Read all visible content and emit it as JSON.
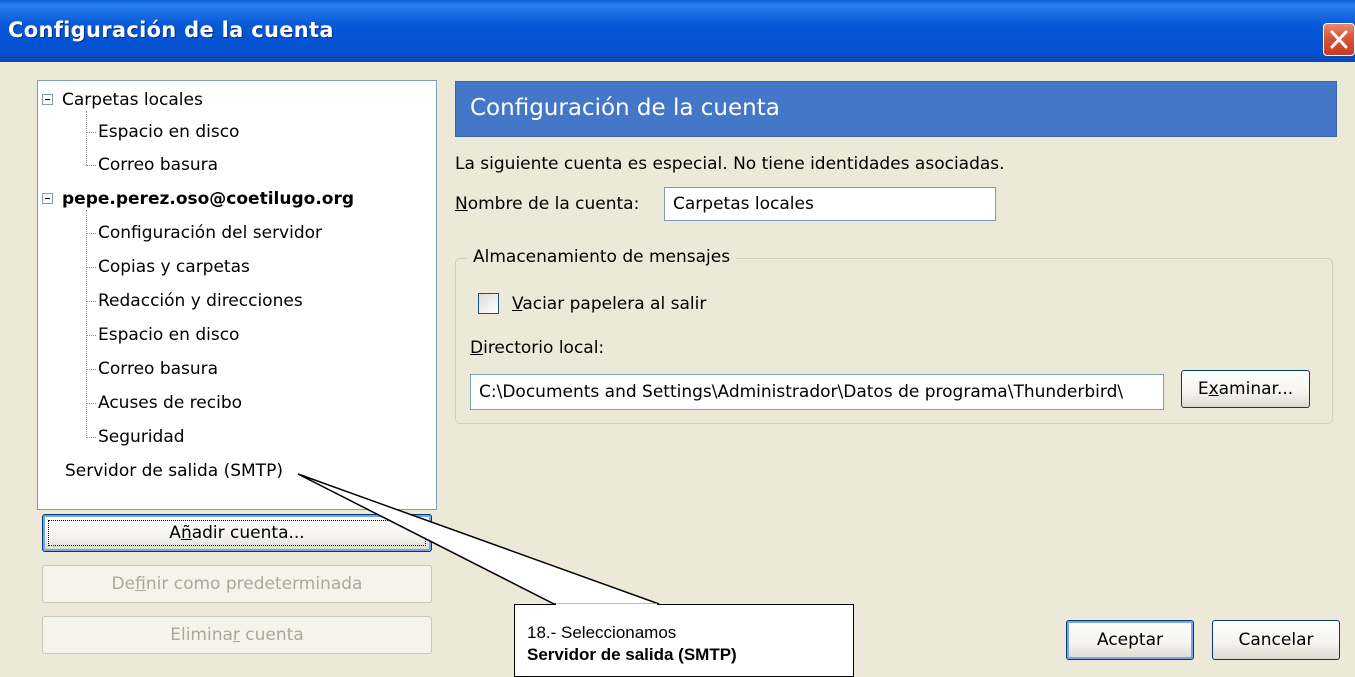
{
  "window": {
    "title": "Configuración de la cuenta"
  },
  "tree": {
    "groups": [
      {
        "label": "Carpetas locales",
        "bold": false,
        "children": [
          "Espacio en disco",
          "Correo basura"
        ]
      },
      {
        "label": "pepe.perez.oso@coetilugo.org",
        "bold": true,
        "children": [
          "Configuración del servidor",
          "Copias y carpetas",
          "Redacción y direcciones",
          "Espacio en disco",
          "Correo basura",
          "Acuses de recibo",
          "Seguridad"
        ]
      }
    ],
    "footer_item": "Servidor de salida (SMTP)"
  },
  "left_buttons": {
    "add_account_prefix": "A",
    "add_account_accel": "ñ",
    "add_account_suffix": "adir cuenta...",
    "set_default_prefix": "De",
    "set_default_accel": "f",
    "set_default_suffix": "inir como predeterminada",
    "delete_prefix": "Elimina",
    "delete_accel": "r",
    "delete_suffix": " cuenta"
  },
  "panel": {
    "header": "Configuración de la cuenta",
    "description": "La siguiente cuenta es especial. No tiene identidades asociadas.",
    "account_name_accel": "N",
    "account_name_label_rest": "ombre de la cuenta:",
    "account_name_value": "Carpetas locales",
    "storage_group_label": "Almacenamiento de mensajes",
    "empty_trash_accel": "V",
    "empty_trash_rest": "aciar papelera al salir",
    "empty_trash_checked": false,
    "local_dir_accel": "D",
    "local_dir_rest": "irectorio local:",
    "local_dir_value": "C:\\Documents and Settings\\Administrador\\Datos de programa\\Thunderbird\\",
    "browse_prefix": "E",
    "browse_accel": "x",
    "browse_suffix": "aminar..."
  },
  "dialog_buttons": {
    "ok": "Aceptar",
    "cancel": "Cancelar"
  },
  "callout": {
    "line1": "18.- Seleccionamos",
    "line2": "Servidor de salida (SMTP)"
  },
  "colors": {
    "titlebar": "#0450d0",
    "header_box": "#4477c8",
    "dialog_bg": "#ece9d8",
    "close_button": "#d85a3a"
  },
  "icons": {
    "close": "close-x-icon",
    "expander": "collapse-minus-icon",
    "checkbox": "checkbox-unchecked"
  }
}
